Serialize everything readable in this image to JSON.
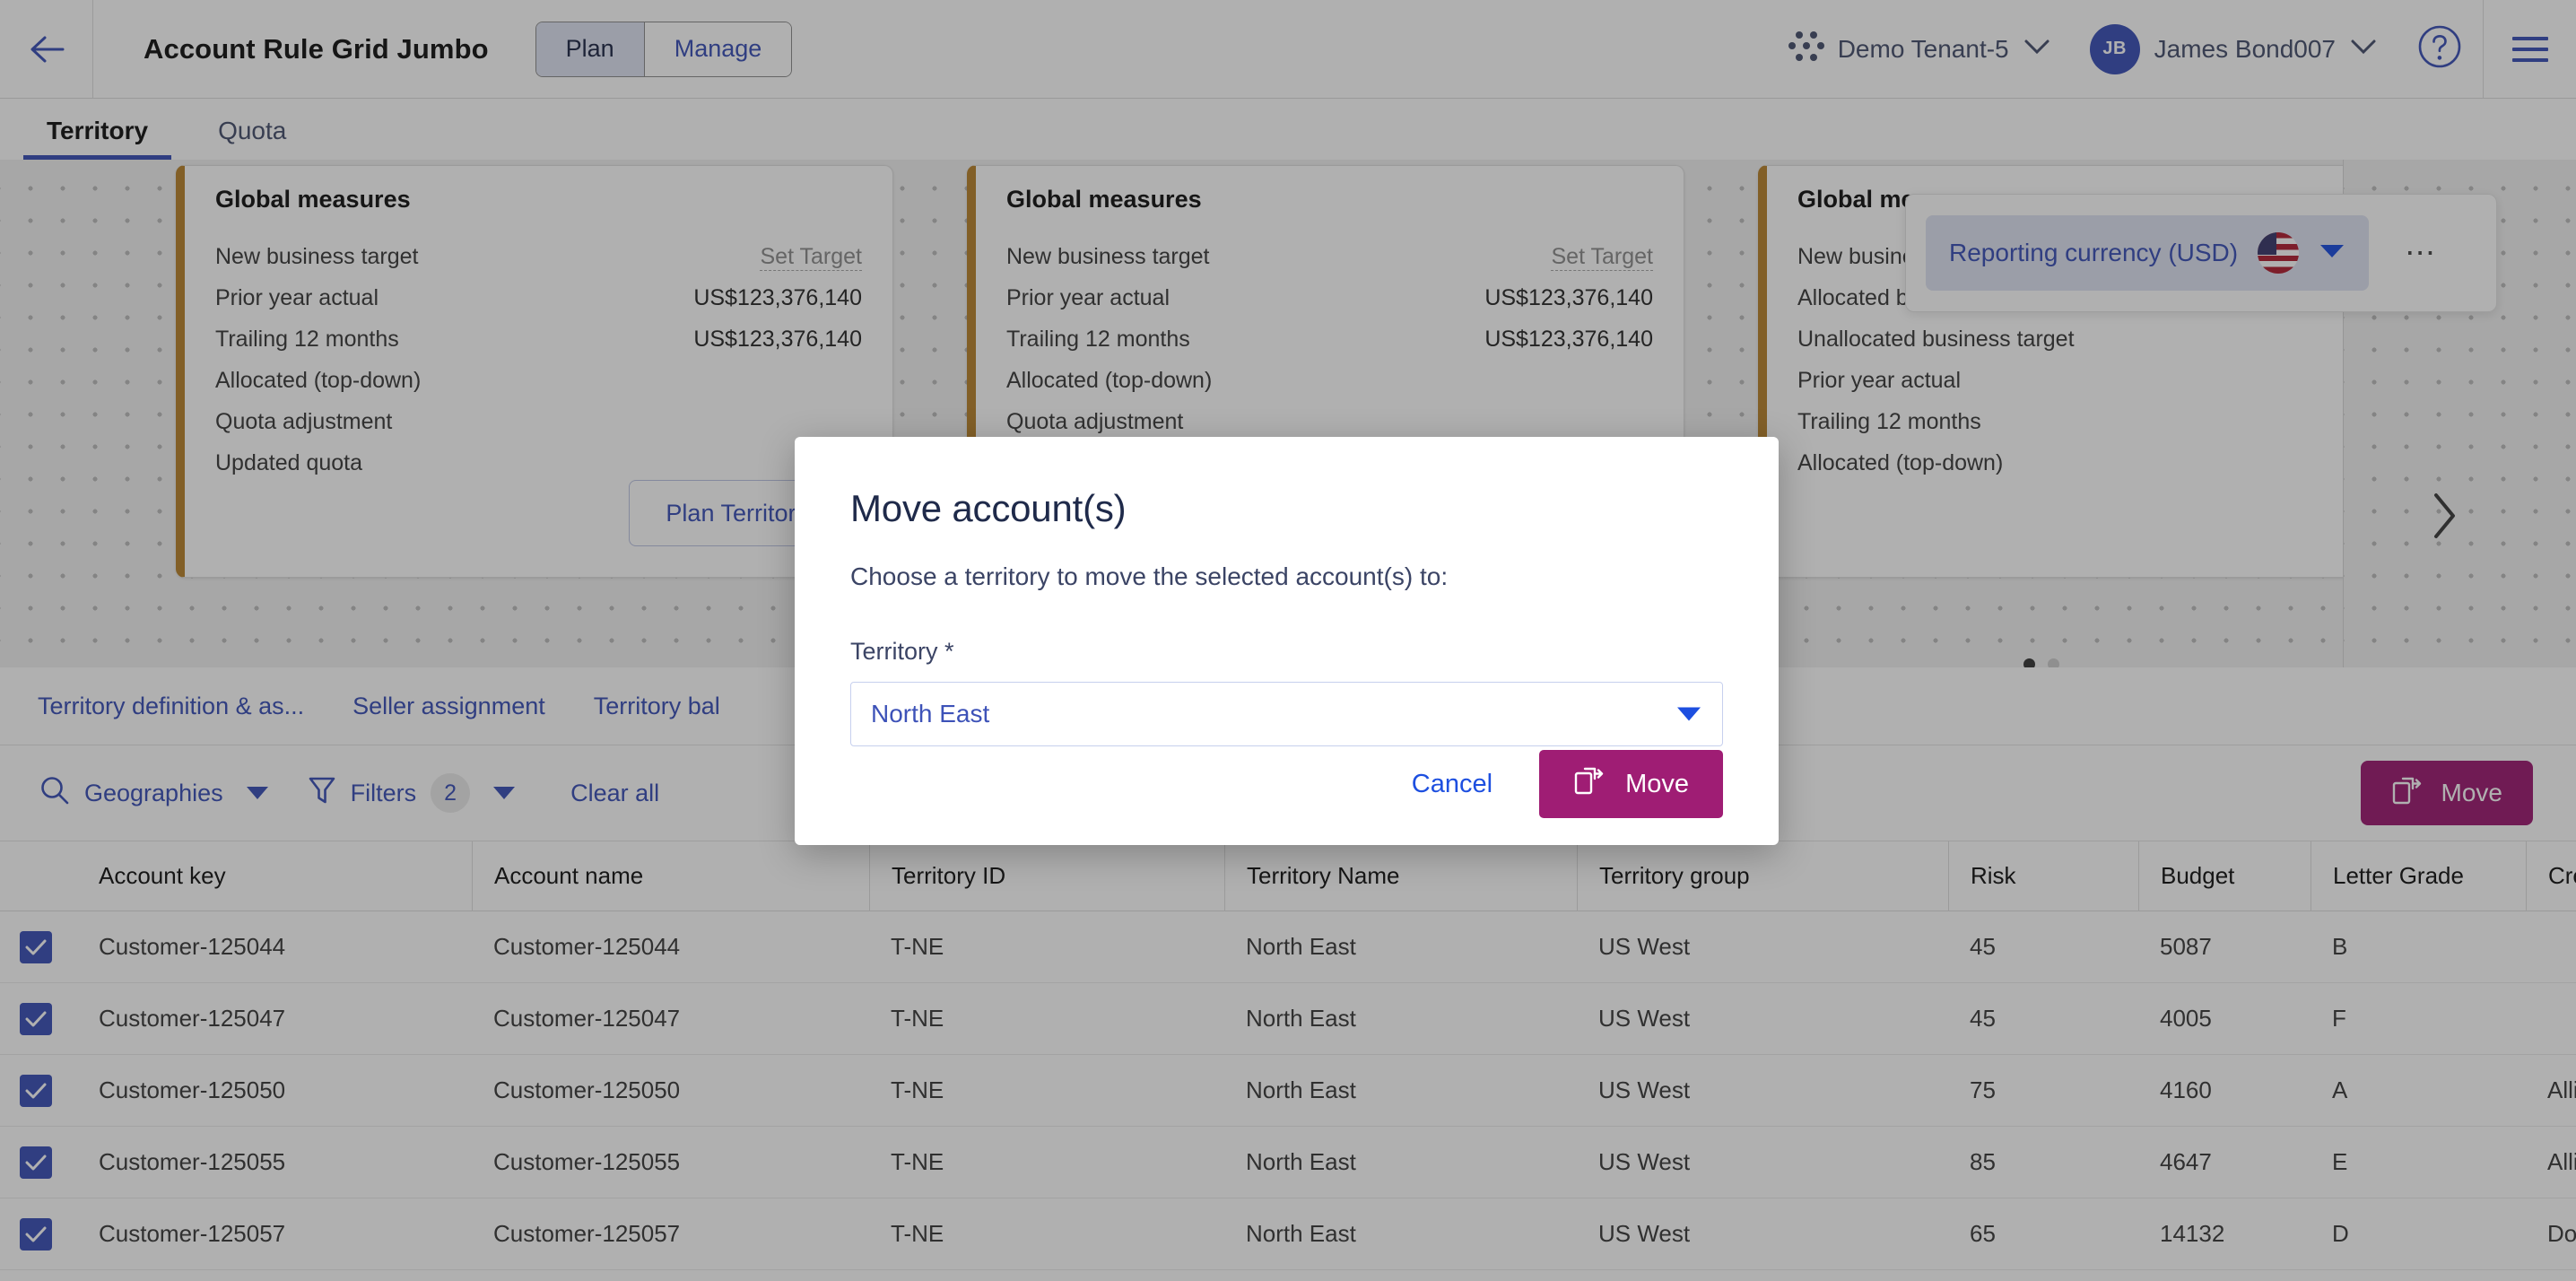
{
  "header": {
    "back_icon": "arrow-left-icon",
    "title": "Account Rule Grid Jumbo",
    "mode_toggle": [
      {
        "label": "Plan",
        "active": true
      },
      {
        "label": "Manage",
        "active": false
      }
    ],
    "tenant": "Demo Tenant-5",
    "user_initials": "JB",
    "user_name": "James Bond007",
    "help_icon": "help-circle-icon",
    "menu_icon": "hamburger-menu-icon"
  },
  "top_tabs": [
    {
      "label": "Territory",
      "active": true
    },
    {
      "label": "Quota",
      "active": false
    }
  ],
  "canvas": {
    "cards": [
      {
        "title": "Global measures",
        "rows": [
          {
            "label": "New business target",
            "value": "Set Target",
            "is_link": true
          },
          {
            "label": "Prior year actual",
            "value": "US$123,376,140",
            "is_link": false
          },
          {
            "label": "Trailing 12 months",
            "value": "US$123,376,140",
            "is_link": false
          },
          {
            "label": "Allocated (top-down)",
            "value": "",
            "is_link": false
          },
          {
            "label": "Quota adjustment",
            "value": "",
            "is_link": false
          },
          {
            "label": "Updated quota",
            "value": "",
            "is_link": false
          }
        ],
        "action_label": "Plan Territories"
      },
      {
        "title": "Global measures",
        "rows": [
          {
            "label": "New business target",
            "value": "Set Target",
            "is_link": true
          },
          {
            "label": "Prior year actual",
            "value": "US$123,376,140",
            "is_link": false
          },
          {
            "label": "Trailing 12 months",
            "value": "US$123,376,140",
            "is_link": false
          },
          {
            "label": "Allocated (top-down)",
            "value": "",
            "is_link": false
          },
          {
            "label": "Quota adjustment",
            "value": "",
            "is_link": false
          },
          {
            "label": "",
            "value": "",
            "is_link": false
          }
        ],
        "action_label": ""
      },
      {
        "title": "Global measures",
        "rows": [
          {
            "label": "New business target",
            "value": "",
            "is_link": false
          },
          {
            "label": "Allocated business target",
            "value": "",
            "is_link": false
          },
          {
            "label": "Unallocated business target",
            "value": "",
            "is_link": false
          },
          {
            "label": "Prior year actual",
            "value": "",
            "is_link": false
          },
          {
            "label": "Trailing 12 months",
            "value": "",
            "is_link": false
          },
          {
            "label": "Allocated (top-down)",
            "value": "",
            "is_link": false
          }
        ],
        "action_label": ""
      }
    ],
    "next_arrow": "chevron-right-icon",
    "currency_flyout": {
      "label": "Reporting currency (USD)",
      "flag": "us-flag-icon",
      "caret": "chevron-down-icon",
      "overflow": "kebab-menu-icon"
    }
  },
  "subnav": [
    {
      "label": "Territory definition & as..."
    },
    {
      "label": "Seller assignment"
    },
    {
      "label": "Territory bal"
    }
  ],
  "toolbar": {
    "geographies_label": "Geographies",
    "search_icon": "search-icon",
    "filters_label": "Filters",
    "filters_icon": "filter-funnel-icon",
    "filters_count": "2",
    "clear_all_label": "Clear all",
    "move_label": "Move",
    "move_icon": "move-copy-icon"
  },
  "grid": {
    "columns": [
      "Account key",
      "Account name",
      "Territory ID",
      "Territory Name",
      "Territory group",
      "Risk",
      "Budget",
      "Letter Grade",
      "Creature"
    ],
    "rows": [
      {
        "checked": true,
        "account_key": "Customer-125044",
        "account_name": "Customer-125044",
        "territory_id": "T-NE",
        "territory_name": "North East",
        "territory_group": "US West",
        "risk": "45",
        "budget": "5087",
        "letter_grade": "B",
        "creature": ""
      },
      {
        "checked": true,
        "account_key": "Customer-125047",
        "account_name": "Customer-125047",
        "territory_id": "T-NE",
        "territory_name": "North East",
        "territory_group": "US West",
        "risk": "45",
        "budget": "4005",
        "letter_grade": "F",
        "creature": ""
      },
      {
        "checked": true,
        "account_key": "Customer-125050",
        "account_name": "Customer-125050",
        "territory_id": "T-NE",
        "territory_name": "North East",
        "territory_group": "US West",
        "risk": "75",
        "budget": "4160",
        "letter_grade": "A",
        "creature": "Alligator"
      },
      {
        "checked": true,
        "account_key": "Customer-125055",
        "account_name": "Customer-125055",
        "territory_id": "T-NE",
        "territory_name": "North East",
        "territory_group": "US West",
        "risk": "85",
        "budget": "4647",
        "letter_grade": "E",
        "creature": "Alligator"
      },
      {
        "checked": true,
        "account_key": "Customer-125057",
        "account_name": "Customer-125057",
        "territory_id": "T-NE",
        "territory_name": "North East",
        "territory_group": "US West",
        "risk": "65",
        "budget": "14132",
        "letter_grade": "D",
        "creature": "Dolphin"
      }
    ]
  },
  "modal": {
    "title": "Move account(s)",
    "description": "Choose a territory to move the selected account(s) to:",
    "field_label": "Territory *",
    "select_value": "North East",
    "cancel_label": "Cancel",
    "confirm_label": "Move",
    "confirm_icon": "move-copy-icon"
  },
  "colors": {
    "brand_blue": "#3d52b8",
    "accent_magenta": "#9f1d74",
    "card_accent": "#b98430",
    "link_blue": "#1d4fe0"
  }
}
